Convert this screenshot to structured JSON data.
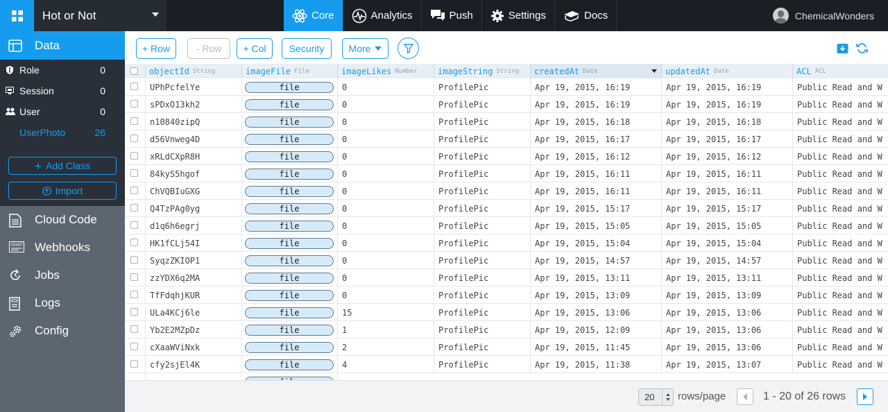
{
  "topbar": {
    "app_name": "Hot or Not",
    "nav": [
      {
        "label": "Core",
        "icon": "atom-icon",
        "active": true
      },
      {
        "label": "Analytics",
        "icon": "pulse-icon",
        "active": false
      },
      {
        "label": "Push",
        "icon": "chat-icon",
        "active": false
      },
      {
        "label": "Settings",
        "icon": "gear-icon",
        "active": false
      },
      {
        "label": "Docs",
        "icon": "book-icon",
        "active": false
      }
    ],
    "username": "ChemicalWonders"
  },
  "sidebar": {
    "section": "Data",
    "classes": [
      {
        "name": "Role",
        "count": "0"
      },
      {
        "name": "Session",
        "count": "0"
      },
      {
        "name": "User",
        "count": "0"
      },
      {
        "name": "UserPhoto",
        "count": "26"
      }
    ],
    "add_class": "Add Class",
    "import": "Import",
    "nav": [
      {
        "label": "Cloud Code"
      },
      {
        "label": "Webhooks"
      },
      {
        "label": "Jobs"
      },
      {
        "label": "Logs"
      },
      {
        "label": "Config"
      }
    ]
  },
  "toolbar": {
    "add_row": "+ Row",
    "remove_row": "- Row",
    "add_col": "+ Col",
    "security": "Security",
    "more": "More"
  },
  "grid": {
    "columns": [
      {
        "name": "objectId",
        "type": "String"
      },
      {
        "name": "imageFile",
        "type": "File"
      },
      {
        "name": "imageLikes",
        "type": "Number"
      },
      {
        "name": "imageString",
        "type": "String"
      },
      {
        "name": "createdAt",
        "type": "Date"
      },
      {
        "name": "updatedAt",
        "type": "Date"
      },
      {
        "name": "ACL",
        "type": "ACL"
      }
    ],
    "file_label": "file",
    "rows": [
      [
        "UPhPcfelYe",
        "file",
        "0",
        "ProfilePic",
        "Apr 19, 2015, 16:19",
        "Apr 19, 2015, 16:19",
        "Public Read and W"
      ],
      [
        "sPDxO13kh2",
        "file",
        "0",
        "ProfilePic",
        "Apr 19, 2015, 16:19",
        "Apr 19, 2015, 16:19",
        "Public Read and W"
      ],
      [
        "n10840zipQ",
        "file",
        "0",
        "ProfilePic",
        "Apr 19, 2015, 16:18",
        "Apr 19, 2015, 16:18",
        "Public Read and W"
      ],
      [
        "d56Vnweg4D",
        "file",
        "0",
        "ProfilePic",
        "Apr 19, 2015, 16:17",
        "Apr 19, 2015, 16:17",
        "Public Read and W"
      ],
      [
        "xRLdCXpR8H",
        "file",
        "0",
        "ProfilePic",
        "Apr 19, 2015, 16:12",
        "Apr 19, 2015, 16:12",
        "Public Read and W"
      ],
      [
        "84kyS5hgof",
        "file",
        "0",
        "ProfilePic",
        "Apr 19, 2015, 16:11",
        "Apr 19, 2015, 16:11",
        "Public Read and W"
      ],
      [
        "ChVQBIuGXG",
        "file",
        "0",
        "ProfilePic",
        "Apr 19, 2015, 16:11",
        "Apr 19, 2015, 16:11",
        "Public Read and W"
      ],
      [
        "Q4TzPAg0yg",
        "file",
        "0",
        "ProfilePic",
        "Apr 19, 2015, 15:17",
        "Apr 19, 2015, 15:17",
        "Public Read and W"
      ],
      [
        "d1q6h6egrj",
        "file",
        "0",
        "ProfilePic",
        "Apr 19, 2015, 15:05",
        "Apr 19, 2015, 15:05",
        "Public Read and W"
      ],
      [
        "HK1fCLj54I",
        "file",
        "0",
        "ProfilePic",
        "Apr 19, 2015, 15:04",
        "Apr 19, 2015, 15:04",
        "Public Read and W"
      ],
      [
        "SyqzZKIOP1",
        "file",
        "0",
        "ProfilePic",
        "Apr 19, 2015, 14:57",
        "Apr 19, 2015, 14:57",
        "Public Read and W"
      ],
      [
        "zzYDX6q2MA",
        "file",
        "0",
        "ProfilePic",
        "Apr 19, 2015, 13:11",
        "Apr 19, 2015, 13:11",
        "Public Read and W"
      ],
      [
        "TfFdqhjKUR",
        "file",
        "0",
        "ProfilePic",
        "Apr 19, 2015, 13:09",
        "Apr 19, 2015, 13:09",
        "Public Read and W"
      ],
      [
        "ULa4KCj6le",
        "file",
        "15",
        "ProfilePic",
        "Apr 19, 2015, 13:06",
        "Apr 19, 2015, 13:06",
        "Public Read and W"
      ],
      [
        "Yb2E2MZpDz",
        "file",
        "1",
        "ProfilePic",
        "Apr 19, 2015, 12:09",
        "Apr 19, 2015, 13:06",
        "Public Read and W"
      ],
      [
        "cXaaWViNxk",
        "file",
        "2",
        "ProfilePic",
        "Apr 19, 2015, 11:45",
        "Apr 19, 2015, 13:06",
        "Public Read and W"
      ],
      [
        "cfy2sjEl4K",
        "file",
        "4",
        "ProfilePic",
        "Apr 19, 2015, 11:38",
        "Apr 19, 2015, 13:07",
        "Public Read and W"
      ]
    ]
  },
  "footer": {
    "per_page": "20",
    "rows_label": "rows/page",
    "range": "1 - 20 of 26 rows"
  }
}
